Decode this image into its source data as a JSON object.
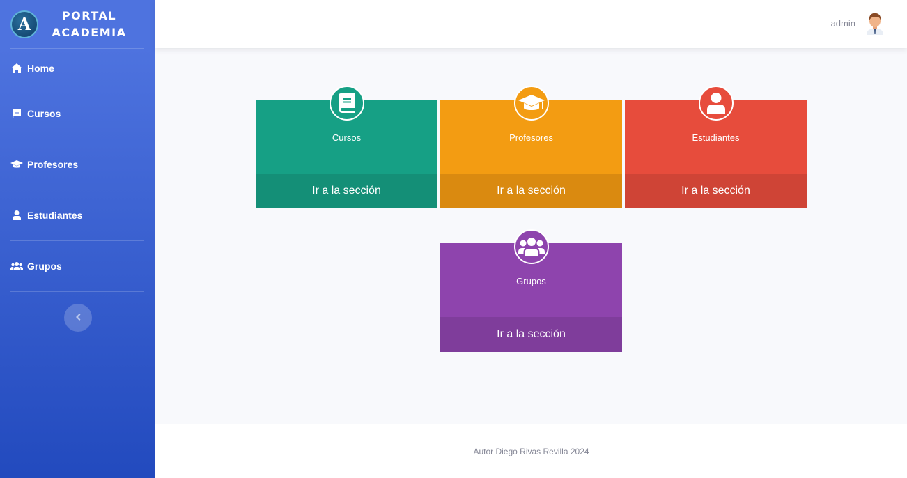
{
  "brand": {
    "logo_letter": "A",
    "line1": "PORTAL",
    "line2": "ACADEMIA"
  },
  "sidebar": {
    "items": [
      {
        "label": "Home",
        "icon": "home-icon"
      },
      {
        "label": "Cursos",
        "icon": "book-icon"
      },
      {
        "label": "Profesores",
        "icon": "graduation-cap-icon"
      },
      {
        "label": "Estudiantes",
        "icon": "user-icon"
      },
      {
        "label": "Grupos",
        "icon": "users-icon"
      }
    ],
    "toggle_icon": "chevron-left-icon"
  },
  "topbar": {
    "username": "admin",
    "avatar_icon": "avatar-icon"
  },
  "cards": [
    {
      "title": "Cursos",
      "link": "Ir a la sección",
      "icon": "book-icon",
      "color": "#16a085",
      "dark": "#148f77"
    },
    {
      "title": "Profesores",
      "link": "Ir a la sección",
      "icon": "graduation-cap-icon",
      "color": "#f39c12",
      "dark": "#da8a10"
    },
    {
      "title": "Estudiantes",
      "link": "Ir a la sección",
      "icon": "user-icon",
      "color": "#e74c3c",
      "dark": "#cf4436"
    },
    {
      "title": "Grupos",
      "link": "Ir a la sección",
      "icon": "users-icon",
      "color": "#8e44ad",
      "dark": "#7f3d9b"
    }
  ],
  "footer": {
    "text": "Autor Diego Rivas Revilla 2024"
  }
}
